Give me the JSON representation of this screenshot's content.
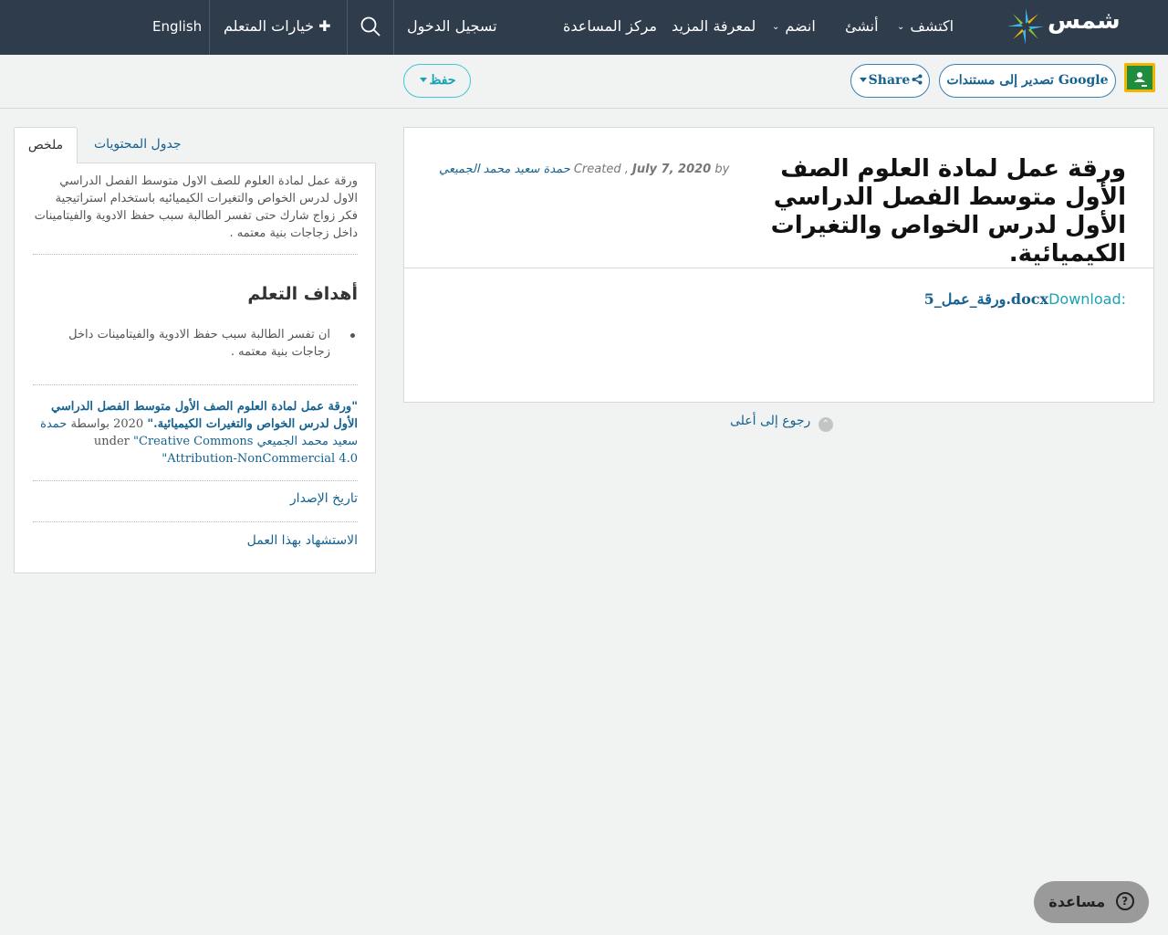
{
  "nav": {
    "logo_text": "شمس",
    "language": "English",
    "learner_options": "خيارات المتعلم",
    "sign_in": "تسجيل الدخول",
    "help_center": "مركز المساعدة",
    "learn_more": "لمعرفة المزيد",
    "join": "انضم",
    "create": "أنشئ",
    "explore": "اكتشف",
    "plus_icon": "plus-icon",
    "search_icon": "search-icon"
  },
  "toolbar": {
    "export_google": "تصدير إلى مستندات Google",
    "share": "Share",
    "save": "حفظ"
  },
  "resource": {
    "title": "ورقة عمل لمادة العلوم الصف الأول متوسط الفصل الدراسي الأول لدرس الخواص والتغيرات الكيميائية.",
    "meta_by": "by",
    "meta_date": "July 7, 2020",
    "meta_created": "Created ,",
    "author": "حمدة سعيد محمد الجميعي",
    "download_label": "Download:",
    "download_file": "ورقة_عمل_5.docx",
    "back_to_top": "رجوع إلى أعلى"
  },
  "sidebar": {
    "tab_summary": "ملخص",
    "tab_toc": "جدول المحتويات",
    "summary": "ورقة عمل لمادة العلوم للصف الاول متوسط الفصل الدراسي الاول لدرس الخواص والتغيرات الكيميائيه باستخدام استراتيجية فكر زواج شارك حتى تفسر الطالبة سبب حفظ الادوية والفيتامينات داخل زجاجات بنية معتمه .",
    "objectives_title": "أهداف التعلم",
    "objective_1": "ان تفسر الطالبة سبب حفظ الادوية والفيتامينات داخل زجاجات بنية معتمه .",
    "citation_title": "\"ورقة عمل لمادة العلوم الصف الأول متوسط الفصل الدراسي الأول لدرس الخواص والتغيرات الكيميائية.\"",
    "citation_year_by": "2020 بواسطة",
    "citation_author": "حمدة سعيد محمد الجميعي",
    "citation_under": "under",
    "citation_license": "\"Creative Commons Attribution-NonCommercial 4.0\"",
    "version_history": "تاريخ الإصدار",
    "cite_this": "الاستشهاد بهذا العمل"
  },
  "help": {
    "label": "مساعدة"
  },
  "colors": {
    "nav_bg": "#2e3c4b",
    "link": "#16628f",
    "accent": "#1aa3b5"
  }
}
